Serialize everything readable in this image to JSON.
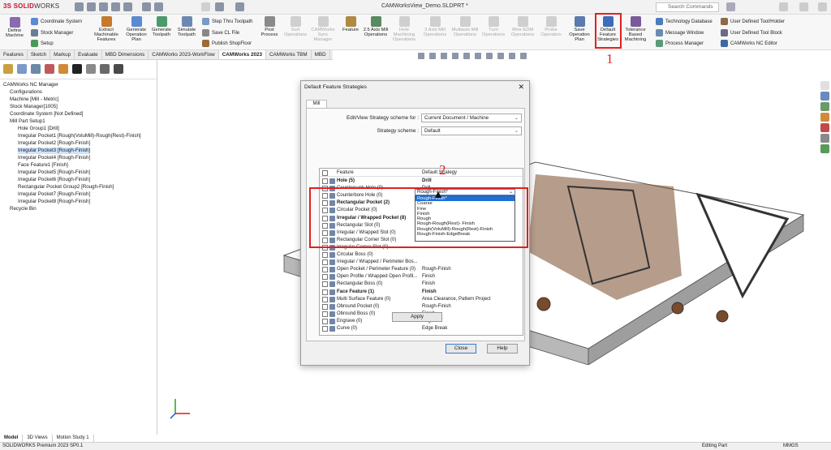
{
  "app": {
    "logo_brand": "3S SOLID",
    "logo_suffix": "WORKS",
    "window_title": "CAMWorksView_Demo.SLDPRT *",
    "search_placeholder": "Search Commands"
  },
  "ribbon": {
    "define_machine": "Define Machine",
    "coordinate_system": "Coordinate System",
    "stock_manager": "Stock Manager",
    "setup": "Setup",
    "extract": "Extract Machinable Features",
    "gen_op_plan": "Generate Operation Plan",
    "gen_toolpath": "Generate Toolpath",
    "simulate": "Simulate Toolpath",
    "step_thru": "Step Thru Toolpath",
    "save_cl": "Save CL File",
    "publish": "Publish ShopFloor",
    "post": "Post Process",
    "sort_ops": "Sort Operations",
    "sync": "CAMWorks Sync Manager",
    "feature": "Feature",
    "axis_mill": "2.5 Axis Mill Operations",
    "hole_mach": "Hole Machining Operations",
    "axis3": "3 Axis Mill Operations",
    "multiaxis": "Multiaxis Mill Operations",
    "turn": "Turn Operations",
    "wire_edm": "Wire EDM Operations",
    "probe": "Probe Operation",
    "save_plan": "Save Operation Plan",
    "default_feature": "Default Feature Strategies",
    "tech_mach": "Tolerance Based Machining",
    "tech_db": "Technology Database",
    "msg_win": "Message Window",
    "proc_mgr": "Process Manager",
    "udt_holder": "User Defined Tool/Holder",
    "udt_block": "User Defined Tool Block",
    "nc_editor": "CAMWorks NC Editor"
  },
  "annotations": {
    "one": "1",
    "two": "2"
  },
  "tabs": [
    "Features",
    "Sketch",
    "Markup",
    "Evaluate",
    "MBD Dimensions",
    "CAMWorks 2023-WorkFlow",
    "CAMWorks 2023",
    "CAMWorks TBM",
    "MBD"
  ],
  "tree": {
    "root": "CAMWorks NC Manager",
    "items": [
      "Configurations",
      "Machine [Mill - Metric]",
      "Stock Manager[1005]",
      "Coordinate System [Not Defined]",
      "Mill Part Setup1",
      "Hole Group1 [Drill]",
      "Irregular Pocket1 [Rough(VoluMill)-Rough(Rest)-Finish]",
      "Irregular Pocket2 [Rough-Finish]",
      "Irregular Pocket3 [Rough-Finish]",
      "Irregular Pocket4 [Rough-Finish]",
      "Face Feature1 [Finish]",
      "Irregular Pocket5 [Rough-Finish]",
      "Irregular Pocket6 [Rough-Finish]",
      "Rectangular Pocket Group2 [Rough-Finish]",
      "Irregular Pocket7 [Rough-Finish]",
      "Irregular Pocket8 [Rough-Finish]",
      "Recycle Bin"
    ]
  },
  "dialog": {
    "title": "Default Feature Strategies",
    "close_glyph": "✕",
    "tab": "Mill",
    "scheme_for_label": "Edit/View Strategy scheme for :",
    "scheme_for_value": "Current Document / Machine",
    "scheme_label": "Strategy scheme :",
    "scheme_value": "Default",
    "col_feature": "Feature",
    "col_strategy": "Default Strategy",
    "rows": [
      {
        "f": "Hole (5)",
        "s": "Drill",
        "b": true
      },
      {
        "f": "Countersunk Hole (0)",
        "s": "Drill",
        "b": false
      },
      {
        "f": "Counterbore Hole (0)",
        "s": "Drill",
        "b": false
      },
      {
        "f": "Rectangular Pocket (2)",
        "s": "Rough-Rough(Rest)- Finish",
        "b": true
      },
      {
        "f": "Circular Pocket (0)",
        "s": "Rough-Rough(Rest)- Finish",
        "b": false
      },
      {
        "f": "Irregular / Wrapped Pocket (8)",
        "s": "",
        "b": true
      },
      {
        "f": "Rectangular Slot (0)",
        "s": "",
        "b": false
      },
      {
        "f": "Irregular / Wrapped Slot (0)",
        "s": "",
        "b": false
      },
      {
        "f": "Rectangular Corner Slot (0)",
        "s": "",
        "b": false
      },
      {
        "f": "Irregular Corner Slot (0)",
        "s": "",
        "b": false
      },
      {
        "f": "Circular Boss (0)",
        "s": "",
        "b": false
      },
      {
        "f": "Irregular / Wrapped / Perimeter Bos...",
        "s": "",
        "b": false
      },
      {
        "f": "Open Pocket / Perimeter Feature (0)",
        "s": "Rough-Finish",
        "b": false
      },
      {
        "f": "Open Profile / Wrapped Open Profil...",
        "s": "Finish",
        "b": false
      },
      {
        "f": "Rectangular Boss (0)",
        "s": "Finish",
        "b": false
      },
      {
        "f": "Face Feature (1)",
        "s": "Finish",
        "b": true
      },
      {
        "f": "Multi Surface Feature (0)",
        "s": "Area Clearance, Pattern Project",
        "b": false
      },
      {
        "f": "Obround Pocket (0)",
        "s": "Rough-Finish",
        "b": false
      },
      {
        "f": "Obround Boss (0)",
        "s": "Finish",
        "b": false
      },
      {
        "f": "Engrave (0)",
        "s": "Engrave",
        "b": false
      },
      {
        "f": "Curve (0)",
        "s": "Edge Break",
        "b": false
      }
    ],
    "dropdown_value": "Rough-Finish*",
    "dropdown_options": [
      "Rough-Finish*",
      "Coarse",
      "Fine",
      "Finish",
      "Rough",
      "Rough-Rough(Rest)- Finish",
      "Rough(VoluMill)-Rough(Rest)-Finish",
      "Rough-Finish-EdgeBreak"
    ],
    "apply": "Apply",
    "close": "Close",
    "help": "Help"
  },
  "bottom_tabs": [
    "Model",
    "3D Views",
    "Motion Study 1"
  ],
  "status": {
    "left": "SOLIDWORKS Premium 2023 SP0.1",
    "mid": "Editing Part",
    "units": "MMGS"
  }
}
